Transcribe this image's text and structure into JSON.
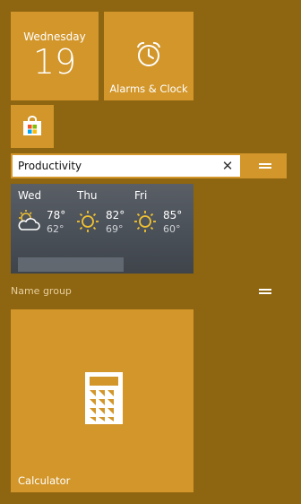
{
  "tiles": {
    "calendar": {
      "day": "Wednesday",
      "date": "19"
    },
    "alarms": {
      "label": "Alarms & Clock",
      "icon": "alarm-clock-icon"
    },
    "store": {
      "icon": "store-bag-icon"
    },
    "calculator": {
      "label": "Calculator",
      "icon": "calculator-icon"
    }
  },
  "group1": {
    "name_input_value": "Productivity",
    "clear_icon": "close-icon"
  },
  "weather": {
    "days": [
      {
        "name": "Wed",
        "high": "78°",
        "low": "62°",
        "icon": "partly-cloudy-icon"
      },
      {
        "name": "Thu",
        "high": "82°",
        "low": "69°",
        "icon": "sun-icon"
      },
      {
        "name": "Fri",
        "high": "85°",
        "low": "60°",
        "icon": "sun-icon"
      }
    ]
  },
  "group2": {
    "name": "Name group"
  },
  "colors": {
    "background": "#8e6510",
    "tile": "#d2962a"
  }
}
